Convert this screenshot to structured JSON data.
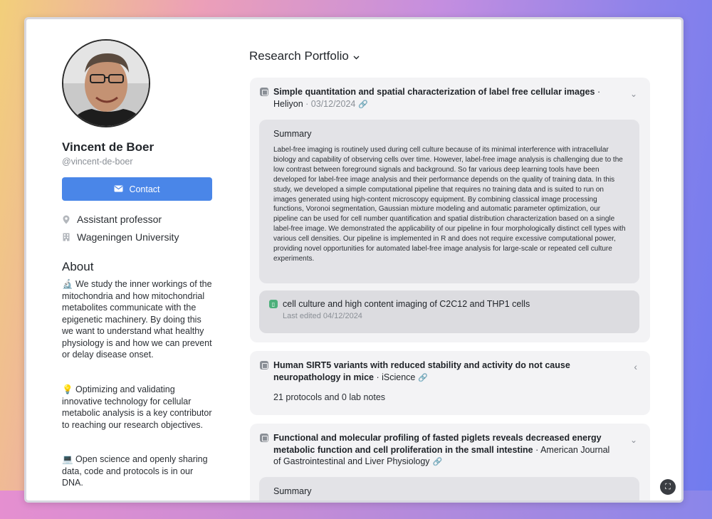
{
  "profile": {
    "name": "Vincent de Boer",
    "handle": "@vincent-de-boer",
    "contact_label": "Contact",
    "role": "Assistant professor",
    "institution": "Wageningen University"
  },
  "about": {
    "title": "About",
    "paragraphs": [
      "🔬 We study the inner workings of the mitochondria and how mitochondrial metabolites communicate with the epigenetic machinery. By doing this we want to understand what healthy physiology is and how we can prevent or delay disease onset.",
      "💡 Optimizing and validating innovative technology for cellular metabolic analysis is a key contributor to reaching our research objectives.",
      "💻 Open science and openly sharing data, code and protocols is in our DNA."
    ]
  },
  "portfolio": {
    "title": "Research Portfolio",
    "items": [
      {
        "title": "Simple quantitation and spatial characterization of label free cellular images",
        "journal": "Heliyon",
        "date": "03/12/2024",
        "summary_title": "Summary",
        "summary": "Label-free imaging is routinely used during cell culture because of its minimal interference with intracellular biology and capability of observing cells over time. However, label-free image analysis is challenging due to the low contrast between foreground signals and background. So far various deep learning tools have been developed for label-free image analysis and their performance depends on the quality of training data. In this study, we developed a simple computational pipeline that requires no training data and is suited to run on images generated using high-content microscopy equipment. By combining classical image processing functions, Voronoi segmentation, Gaussian mixture modeling and automatic parameter optimization, our pipeline can be used for cell number quantification and spatial distribution characterization based on a single label-free image. We demonstrated the applicability of our pipeline in four morphologically distinct cell types with various cell densities. Our pipeline is implemented in R and does not require excessive computational power, providing novel opportunities for automated label-free image analysis for large-scale or repeated cell culture experiments.",
        "protocol_title": "cell culture and high content imaging of C2C12 and THP1 cells",
        "protocol_edited": "Last edited 04/12/2024"
      },
      {
        "title": "Human SIRT5 variants with reduced stability and activity do not cause neuropathology in mice",
        "journal": "iScience",
        "counts": "21 protocols and 0 lab notes"
      },
      {
        "title": "Functional and molecular profiling of fasted piglets reveals decreased energy metabolic function and cell proliferation in the small intestine",
        "journal": "American Journal of Gastrointestinal and Liver Physiology",
        "summary_title": "Summary"
      }
    ]
  }
}
